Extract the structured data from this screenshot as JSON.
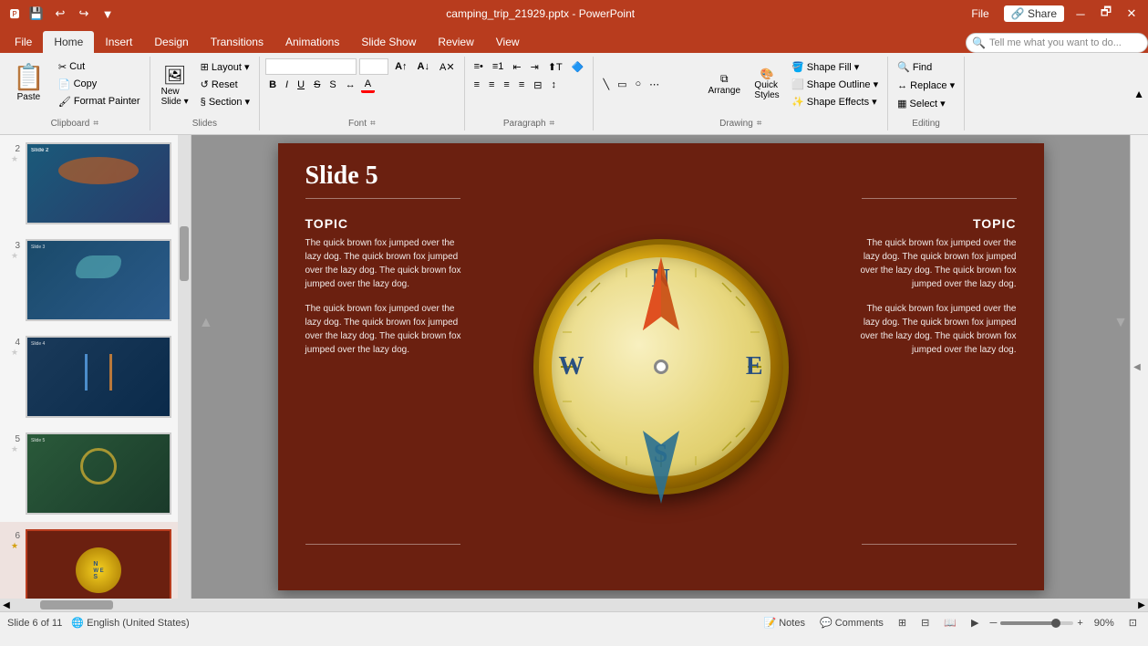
{
  "titlebar": {
    "filename": "camping_trip_21929.pptx - PowerPoint",
    "quickaccess": [
      "save",
      "undo",
      "redo",
      "customize"
    ],
    "windowbtns": [
      "minimize",
      "restore",
      "close"
    ]
  },
  "ribbon": {
    "tabs": [
      "File",
      "Home",
      "Insert",
      "Design",
      "Transitions",
      "Animations",
      "Slide Show",
      "Review",
      "View"
    ],
    "activeTab": "Home",
    "groups": {
      "clipboard": {
        "label": "Clipboard",
        "paste": "Paste",
        "cut": "Cut",
        "copy": "Copy",
        "formatPainter": "Format Painter"
      },
      "slides": {
        "label": "Slides",
        "newSlide": "New Slide",
        "layout": "Layout",
        "reset": "Reset",
        "section": "Section"
      },
      "font": {
        "label": "Font",
        "fontName": "",
        "fontSize": "",
        "bold": "B",
        "italic": "I",
        "underline": "U",
        "strikethrough": "S",
        "shadow": "S",
        "fontColor": "A",
        "increaseSize": "A",
        "decreaseSize": "A",
        "clearFormatting": "A",
        "charSpacing": ""
      },
      "paragraph": {
        "label": "Paragraph"
      },
      "drawing": {
        "label": "Drawing",
        "arrange": "Arrange",
        "quickStyles": "Quick Styles",
        "shapeOutline": "Shape Outline",
        "shapeFill": "Shape Fill",
        "shapeEffects": "Shape Effects",
        "shape": "Shape"
      },
      "editing": {
        "label": "Editing",
        "find": "Find",
        "replace": "Replace",
        "select": "Select"
      }
    },
    "searchBox": {
      "placeholder": "Tell me what you want to do..."
    }
  },
  "slides": [
    {
      "number": "2",
      "starred": true
    },
    {
      "number": "3",
      "starred": true
    },
    {
      "number": "4",
      "starred": true
    },
    {
      "number": "5",
      "starred": true
    },
    {
      "number": "6",
      "starred": true,
      "active": true
    }
  ],
  "currentSlide": {
    "number": 6,
    "title": "Slide 5",
    "topicLeft": {
      "label": "TOPIC",
      "text1": "The quick brown fox jumped over the lazy dog. The quick brown fox jumped over the lazy dog. The quick brown fox jumped over the lazy dog.",
      "text2": "The quick brown fox jumped over the lazy dog. The quick brown fox jumped over the lazy dog. The quick brown fox jumped over the lazy dog."
    },
    "topicRight": {
      "label": "TOPIC",
      "text1": "The quick brown fox jumped over the lazy dog. The quick brown fox jumped over the lazy dog. The quick brown fox jumped over the lazy dog.",
      "text2": "The quick brown fox jumped over the lazy dog. The quick brown fox jumped over the lazy dog. The quick brown fox jumped over the lazy dog."
    },
    "compass": {
      "N": "N",
      "S": "S",
      "E": "E",
      "W": "W"
    }
  },
  "statusbar": {
    "slideInfo": "Slide 6 of 11",
    "language": "English (United States)",
    "notes": "Notes",
    "comments": "Comments",
    "zoom": "90%",
    "views": [
      "normal",
      "slide-sorter",
      "reading",
      "slide-show"
    ]
  }
}
